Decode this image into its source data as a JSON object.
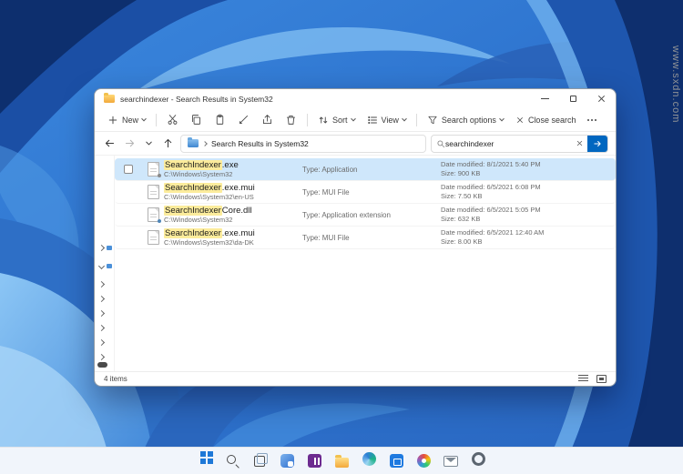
{
  "watermark": "www.sxdn.com",
  "colors": {
    "accent": "#0067c0",
    "selection": "#cfe7fb",
    "search_highlight": "#fcec9c"
  },
  "explorer": {
    "title": "searchindexer - Search Results in System32",
    "toolbar": {
      "new": "New",
      "sort": "Sort",
      "view": "View",
      "search_options": "Search options",
      "close_search": "Close search"
    },
    "nav": {
      "breadcrumb": "Search Results in System32",
      "search_value": "searchindexer"
    },
    "files": [
      {
        "kind": "exe",
        "selected": true,
        "hl": "SearchIndexer",
        "rest": ".exe",
        "path": "C:\\Windows\\System32",
        "type": "Type: Application",
        "date": "Date modified: 8/1/2021 5:40 PM",
        "size": "Size: 900 KB"
      },
      {
        "kind": "mui",
        "selected": false,
        "hl": "SearchIndexer",
        "rest": ".exe.mui",
        "path": "C:\\Windows\\System32\\en-US",
        "type": "Type: MUI File",
        "date": "Date modified: 6/5/2021 6:08 PM",
        "size": "Size: 7.50 KB"
      },
      {
        "kind": "dll",
        "selected": false,
        "hl": "SearchIndexer",
        "rest": "Core.dll",
        "path": "C:\\Windows\\System32",
        "type": "Type: Application extension",
        "date": "Date modified: 6/5/2021 5:05 PM",
        "size": "Size: 632 KB"
      },
      {
        "kind": "mui",
        "selected": false,
        "hl": "SearchIndexer",
        "rest": ".exe.mui",
        "path": "C:\\Windows\\System32\\da-DK",
        "type": "Type: MUI File",
        "date": "Date modified: 6/5/2021 12:40 AM",
        "size": "Size: 8.00 KB"
      }
    ],
    "status": {
      "items": "4 items"
    }
  },
  "taskbar": {
    "icons": [
      "start",
      "search",
      "task-view",
      "widgets",
      "onenote",
      "file-explorer",
      "edge",
      "store",
      "photos",
      "mail",
      "settings"
    ]
  }
}
